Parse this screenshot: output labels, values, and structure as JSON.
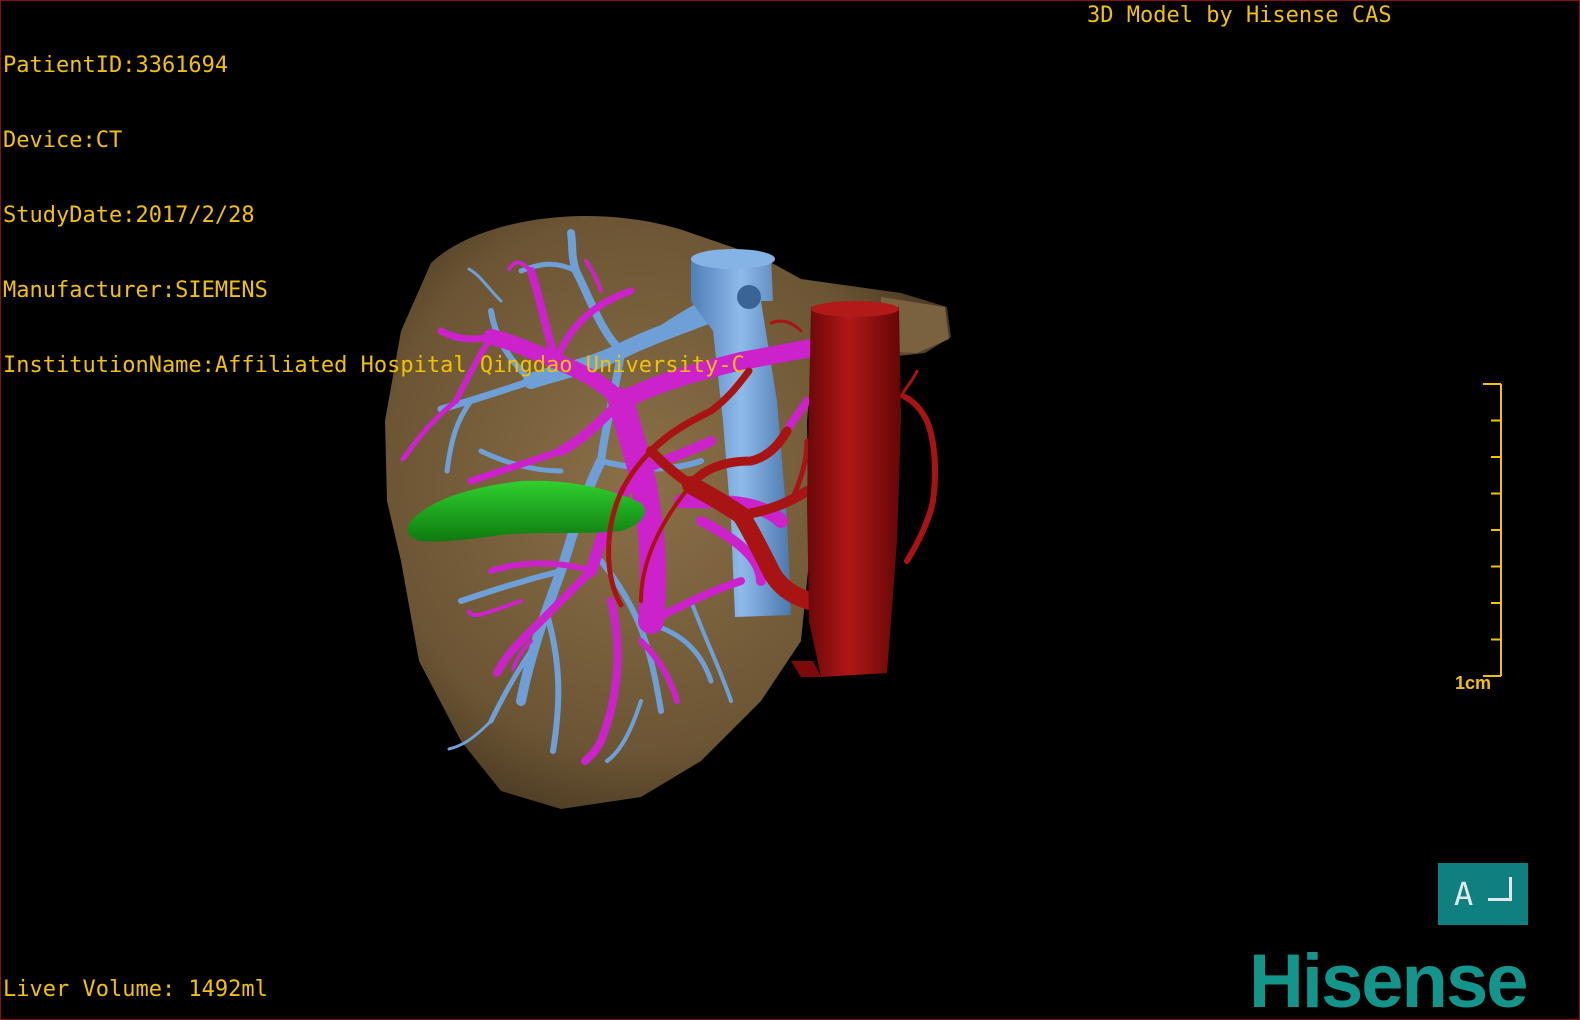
{
  "header": {
    "patient_id": "PatientID:3361694",
    "device": "Device:CT",
    "study_date": "StudyDate:2017/2/28",
    "manufacturer": "Manufacturer:SIEMENS",
    "institution": "InstitutionName:Affiliated Hospital Qingdao University-C"
  },
  "credit": "3D Model by Hisense CAS",
  "footer": {
    "liver_volume": "Liver Volume: 1492ml"
  },
  "scale_bar": {
    "label": "1cm"
  },
  "orientation": {
    "label": "A",
    "icon": "orientation-corner-icon"
  },
  "logo": "Hisense",
  "colors": {
    "text": "#f2c200",
    "liver": "#6e5838",
    "portal_vein": "#cc22cc",
    "hepatic_vein": "#6e9fd6",
    "artery": "#a01010",
    "gallbladder": "#1aa81a",
    "brand": "#14958c"
  }
}
